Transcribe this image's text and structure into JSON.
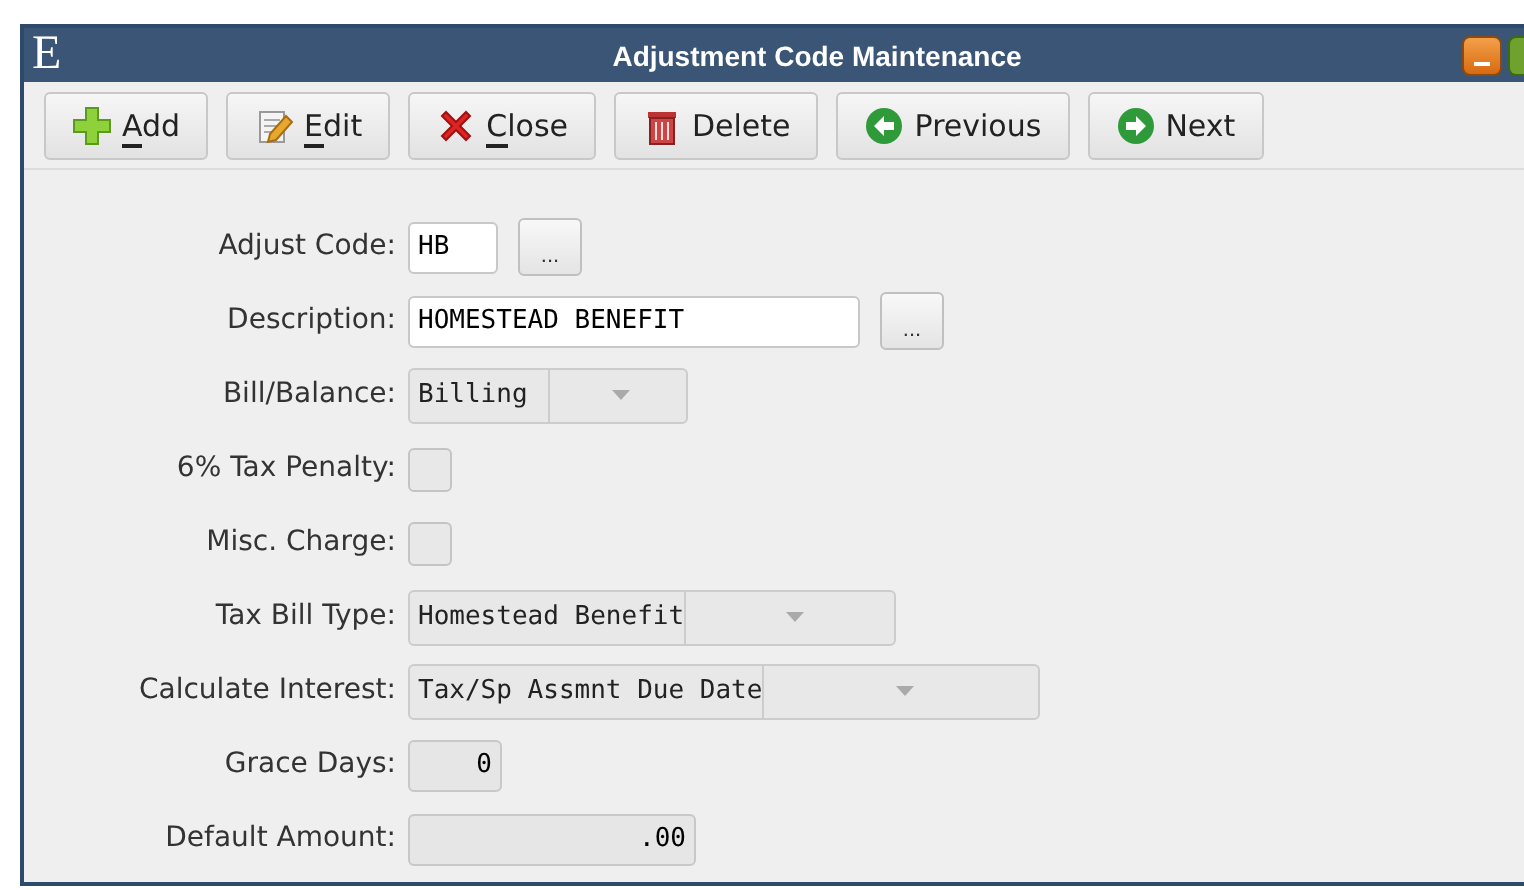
{
  "window": {
    "logo": "E",
    "title": "Adjustment Code Maintenance"
  },
  "toolbar": [
    {
      "kind": "add",
      "label": "Add",
      "underlined": true
    },
    {
      "kind": "edit",
      "label": "Edit",
      "underlined": true
    },
    {
      "kind": "close",
      "label": "Close",
      "underlined": true
    },
    {
      "kind": "delete",
      "label": "Delete",
      "underlined": false
    },
    {
      "kind": "previous",
      "label": "Previous",
      "underlined": false
    },
    {
      "kind": "next",
      "label": "Next",
      "underlined": false
    }
  ],
  "fields": [
    {
      "kind": "text",
      "label": "Adjust Code:",
      "value": "HB",
      "lookup": "...",
      "disabled": false
    },
    {
      "kind": "text",
      "label": "Description:",
      "value": "HOMESTEAD BENEFIT",
      "lookup": "...",
      "disabled": false
    },
    {
      "kind": "combo",
      "label": "Bill/Balance:",
      "value": "Billing"
    },
    {
      "kind": "checkbox",
      "label": "6% Tax Penalty:",
      "checked": false
    },
    {
      "kind": "checkbox",
      "label": "Misc. Charge:",
      "checked": false
    },
    {
      "kind": "combo",
      "label": "Tax Bill Type:",
      "value": "Homestead Benefit"
    },
    {
      "kind": "combo",
      "label": "Calculate Interest:",
      "value": "Tax/Sp Assmnt Due Date"
    },
    {
      "kind": "number",
      "label": "Grace Days:",
      "value": "0",
      "disabled": true
    },
    {
      "kind": "number",
      "label": "Default Amount:",
      "value": ".00",
      "disabled": true
    }
  ]
}
